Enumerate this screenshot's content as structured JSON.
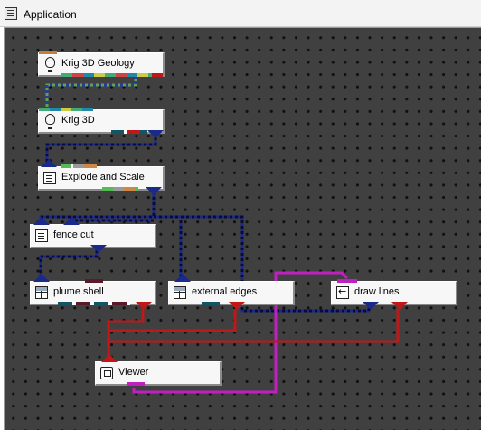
{
  "window": {
    "title": "Application",
    "icon": "application-icon"
  },
  "modules": {
    "krig_3d_geology": {
      "label": "Krig 3D Geology",
      "icon": "lightbulb-icon"
    },
    "krig_3d": {
      "label": "Krig 3D",
      "icon": "lightbulb-icon"
    },
    "explode_and_scale": {
      "label": "Explode and Scale",
      "icon": "document-icon"
    },
    "fence_cut": {
      "label": "fence cut",
      "icon": "document-icon"
    },
    "plume_shell": {
      "label": "plume shell",
      "icon": "grid-icon"
    },
    "external_edges": {
      "label": "external edges",
      "icon": "grid-icon"
    },
    "draw_lines": {
      "label": "draw lines",
      "icon": "arrow-icon"
    },
    "viewer": {
      "label": "Viewer",
      "icon": "viewer-icon"
    }
  },
  "colors": {
    "canvas": "#404040",
    "field_port": "#1a2a8a",
    "render_port": "#c01818",
    "line_port": "#c020c0",
    "geology_port": "#55aa55"
  }
}
